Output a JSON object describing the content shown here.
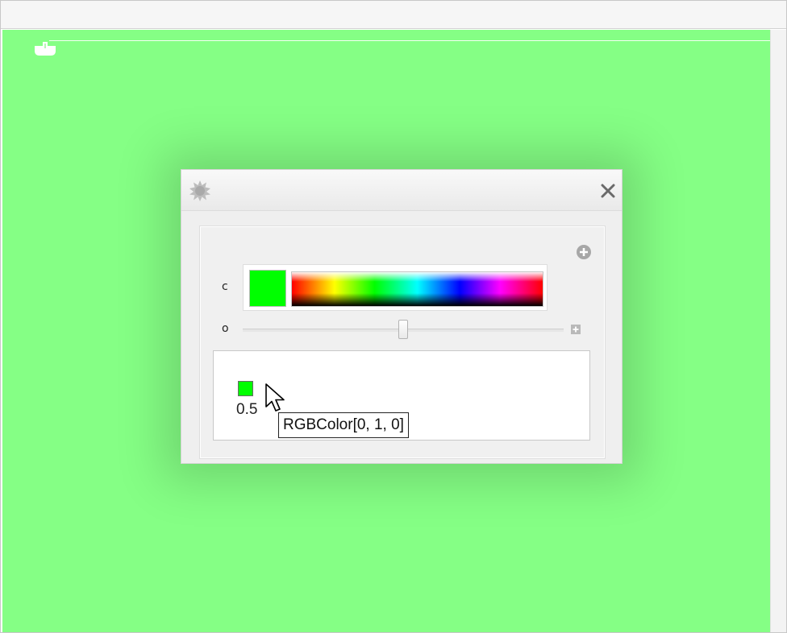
{
  "control_panel": {
    "labels": {
      "color_var": "c",
      "opacity_var": "o"
    },
    "color_picker": {
      "selected_color": "#00ff00"
    },
    "opacity_slider": {
      "value": 0.5
    },
    "output": {
      "swatch_color": "#00ff00",
      "value_text": "0.5"
    },
    "tooltip": {
      "text": "RGBColor[0,  1,  0]"
    }
  },
  "canvas": {
    "background_color": "#85ff85"
  },
  "icons": {
    "title_bar": "gear-icon",
    "close": "close-icon",
    "add": "add-icon",
    "expand": "expand-icon",
    "cell": "cell-icon",
    "pointer": "cursor-icon"
  }
}
